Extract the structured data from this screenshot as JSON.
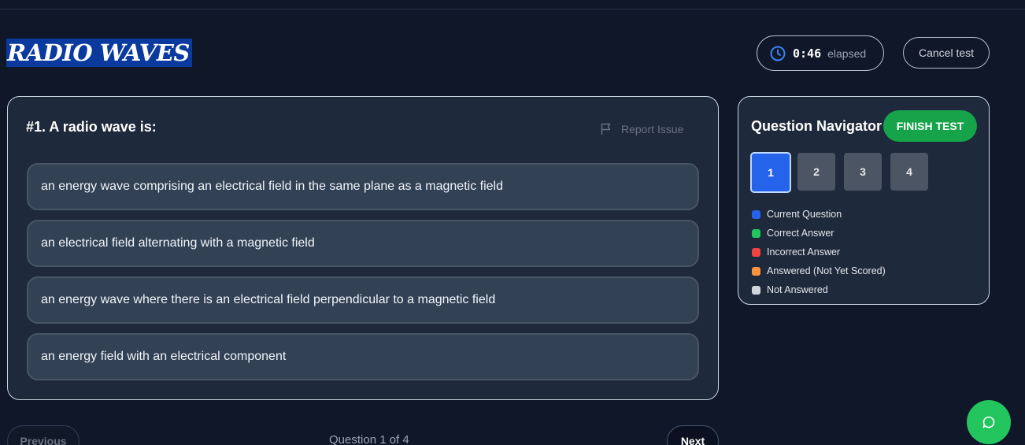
{
  "header": {
    "title": "RADIO WAVES",
    "timer": {
      "time": "0:46",
      "label": "elapsed",
      "icon": "clock-icon"
    },
    "cancel_label": "Cancel test"
  },
  "question": {
    "title": "#1. A radio wave is:",
    "report_label": "Report Issue",
    "report_icon": "flag-icon",
    "options": [
      "an energy wave comprising an electrical field in the same plane as a magnetic field",
      "an electrical field alternating with a magnetic field",
      "an energy wave where there is an electrical field perpendicular to a magnetic field",
      "an energy field with an electrical component"
    ]
  },
  "navigator": {
    "title": "Question Navigator",
    "finish_label": "FINISH TEST",
    "questions": [
      "1",
      "2",
      "3",
      "4"
    ],
    "current": "1",
    "legend": [
      {
        "label": "Current Question",
        "color": "#2563eb"
      },
      {
        "label": "Correct Answer",
        "color": "#22c55e"
      },
      {
        "label": "Incorrect Answer",
        "color": "#ef4444"
      },
      {
        "label": "Answered (Not Yet Scored)",
        "color": "#fb923c"
      },
      {
        "label": "Not Answered",
        "color": "#d1d5db"
      }
    ]
  },
  "footer": {
    "previous_label": "Previous",
    "counter": "Question 1 of 4",
    "next_label": "Next",
    "chat_icon": "chat-icon"
  },
  "colors": {
    "background": "#0f1729",
    "card": "#1e293b",
    "accent": "#2563eb",
    "success": "#16a34a"
  }
}
